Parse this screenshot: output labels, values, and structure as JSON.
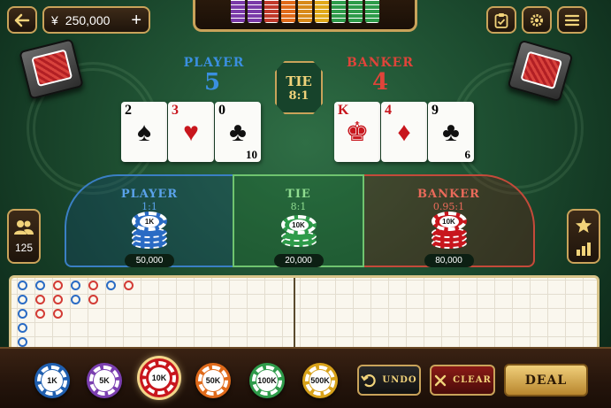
{
  "top_bar": {
    "currency_symbol": "¥",
    "balance": "250,000",
    "plus": "+",
    "back_icon": "arrow-left-icon",
    "history_icon": "clipboard-check-icon",
    "settings_icon": "gear-icon",
    "menu_icon": "hamburger-menu-icon"
  },
  "chip_tray_colors": [
    "#7a3aa8",
    "#7a3aa8",
    "#c0392b",
    "#e06a1a",
    "#d88a1a",
    "#e0a81a",
    "#2e9b4a",
    "#2e9b4a",
    "#2e9b4a"
  ],
  "player": {
    "label": "PLAYER",
    "score": "5",
    "color": "#3a8fe0"
  },
  "banker": {
    "label": "BANKER",
    "score": "4",
    "color": "#e0443a"
  },
  "tie": {
    "label": "TIE",
    "odds": "8:1"
  },
  "player_cards": [
    {
      "rank": "2",
      "suit": "♠",
      "corner": "",
      "color": "blk"
    },
    {
      "rank": "3",
      "suit": "♥",
      "corner": "",
      "color": "red"
    },
    {
      "rank": "0",
      "suit": "♣",
      "corner": "10",
      "color": "blk"
    }
  ],
  "banker_cards": [
    {
      "rank": "K",
      "suit": "♚",
      "corner": "",
      "color": "red"
    },
    {
      "rank": "4",
      "suit": "♦",
      "corner": "",
      "color": "red"
    },
    {
      "rank": "9",
      "suit": "♣",
      "corner": "6",
      "color": "blk"
    }
  ],
  "bets": {
    "player": {
      "label": "PLAYER",
      "odds": "1:1",
      "chip": "1K",
      "amount": "50,000",
      "chip_color": "#2a6bc4"
    },
    "tie": {
      "label": "TIE",
      "odds": "8:1",
      "chip": "10K",
      "amount": "20,000",
      "chip_color": "#2e9b4a"
    },
    "banker": {
      "label": "BANKER",
      "odds": "0.95:1",
      "chip": "10K",
      "amount": "80,000",
      "chip_color": "#c8161d"
    }
  },
  "players_online": {
    "icon": "users-icon",
    "count": "125"
  },
  "right_panel": {
    "star_icon": "star-icon",
    "stats_icon": "bar-chart-icon"
  },
  "roadmap": {
    "beads": [
      [
        "P",
        "P",
        "B",
        "P",
        "B",
        "P",
        "B"
      ],
      [
        "P",
        "B",
        "B",
        "P",
        "B"
      ],
      [
        "P",
        "B",
        "B"
      ],
      [
        "P"
      ],
      [
        "P"
      ]
    ]
  },
  "chips": [
    {
      "label": "1K",
      "color": "#1f5fb0"
    },
    {
      "label": "5K",
      "color": "#7b3fb0"
    },
    {
      "label": "10K",
      "color": "#c8161d",
      "selected": true
    },
    {
      "label": "50K",
      "color": "#e06a1a"
    },
    {
      "label": "100K",
      "color": "#2e9b4a"
    },
    {
      "label": "500K",
      "color": "#d8a21a"
    }
  ],
  "actions": {
    "undo": "UNDO",
    "clear": "CLEAR",
    "deal": "DEAL"
  }
}
